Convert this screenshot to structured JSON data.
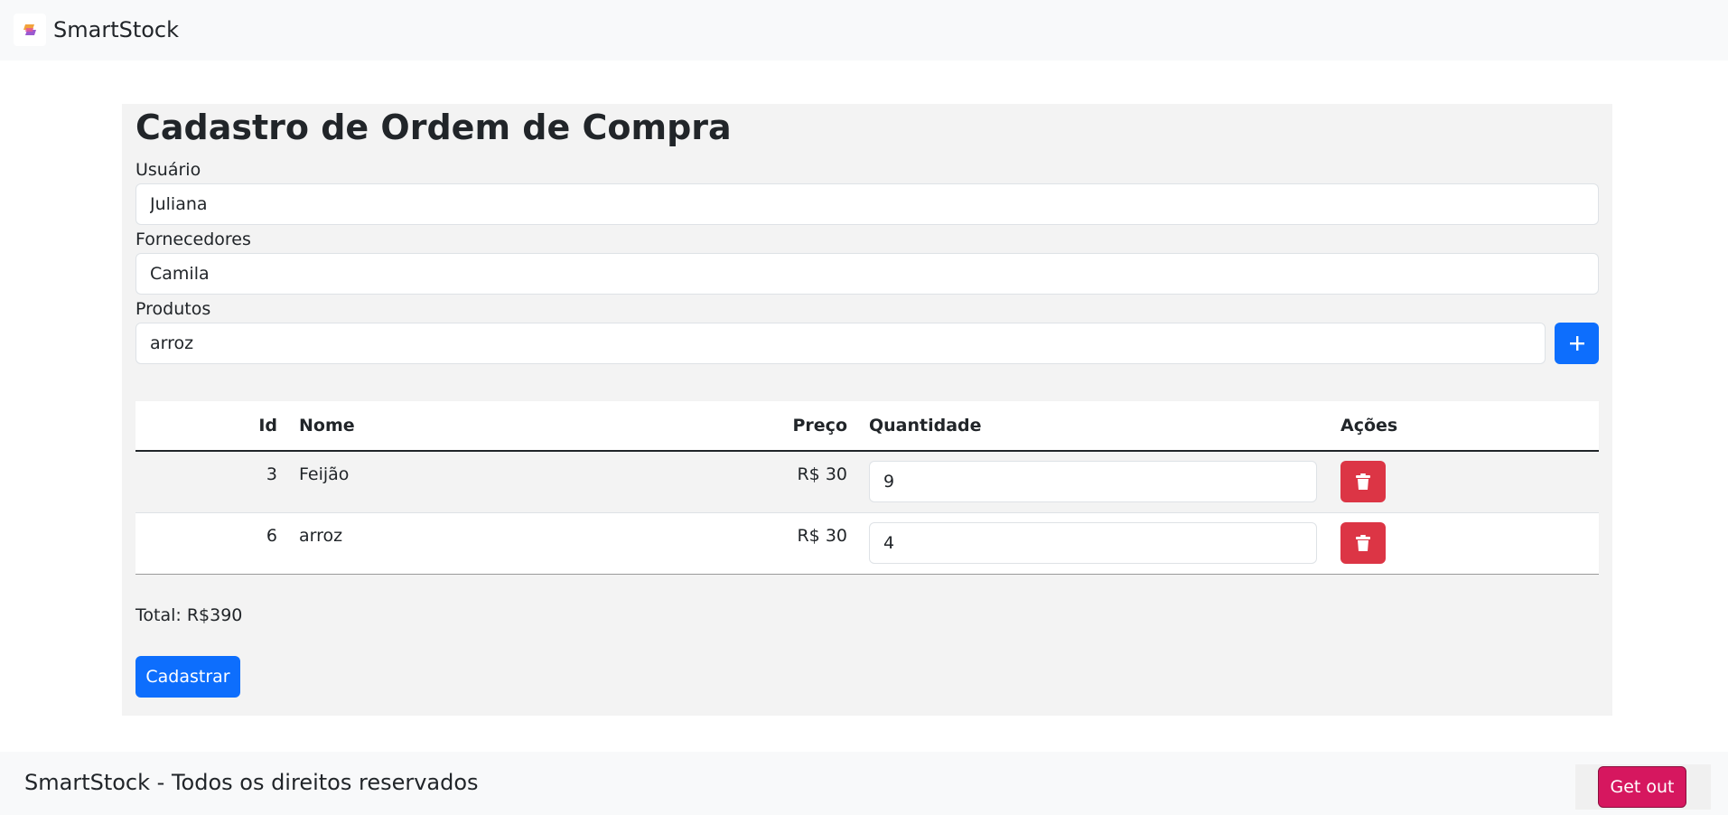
{
  "navbar": {
    "brand": "SmartStock",
    "logo_icon": "app-logo-icon"
  },
  "form": {
    "title": "Cadastro de Ordem de Compra",
    "user_label": "Usuário",
    "user_value": "Juliana",
    "supplier_label": "Fornecedores",
    "supplier_value": "Camila",
    "products_label": "Produtos",
    "products_value": "arroz",
    "add_icon": "plus-icon"
  },
  "table": {
    "headers": {
      "id": "Id",
      "name": "Nome",
      "price": "Preço",
      "qty": "Quantidade",
      "actions": "Ações"
    },
    "rows": [
      {
        "id": "3",
        "name": "Feijão",
        "price": "R$ 30",
        "qty": "9",
        "action_icon": "trash-icon"
      },
      {
        "id": "6",
        "name": "arroz",
        "price": "R$ 30",
        "qty": "4",
        "action_icon": "trash-icon"
      }
    ]
  },
  "total": "Total: R$390",
  "submit_label": "Cadastrar",
  "footer": {
    "text": "SmartStock - Todos os direitos reservados",
    "logout_label": "Get out"
  },
  "colors": {
    "primary": "#0d6efd",
    "danger": "#dc3545",
    "logout": "#d6175f",
    "card_bg": "#f3f3f3"
  }
}
